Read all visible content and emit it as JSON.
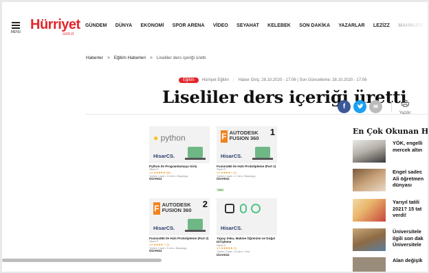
{
  "nav": {
    "menu_label": "MENU",
    "logo": "Hürriyet",
    "logo_sub": "com.tr",
    "items": [
      "GÜNDEM",
      "DÜNYA",
      "EKONOMİ",
      "SPOR ARENA",
      "VİDEO",
      "SEYAHAT",
      "KELEBEK",
      "SON DAKİKA",
      "YAZARLAR",
      "LEZİZZ",
      "MAHMURE"
    ]
  },
  "breadcrumb": {
    "items": [
      "Haberler",
      "Eğitim Haberleri",
      "Liseliler ders içeriği üretti"
    ],
    "separator": ">"
  },
  "meta": {
    "tag": "Eğitim",
    "source": "Hürriyet Eğitim",
    "dates": "Haber Giriş: 28.10.2020 - 17:06 | Son Güncelleme: 28.10.2020 - 17:06"
  },
  "article": {
    "title": "Liseliler ders içeriği üretti"
  },
  "share": {
    "facebook": "f",
    "twitter": "t",
    "email": "✉",
    "print_label": "Yazdır"
  },
  "courses": [
    {
      "brand": "python",
      "hisar": "HisarCS.",
      "title": "Python ile Programlamaya Giriş",
      "provider": "HisarCS",
      "rating": "4.8 ★★★★★ (66)",
      "meta": "Toplam 1 saat • 14 ders • Başlangıç",
      "price": "Ücretsiz",
      "badge": ""
    },
    {
      "brand": "AUTODESK FUSION 360",
      "hisar": "HisarCS.",
      "num": "1",
      "title": "Fusion360 ile Hızlı Prototipleme (Part 1)",
      "provider": "HisarCS",
      "rating": "4.0 ★★★★☆ (2)",
      "meta": "Toplam 1 saat • 17 ders • Başlangıç",
      "price": "Ücretsiz",
      "badge": "Yeni"
    },
    {
      "brand": "AUTODESK FUSION 360",
      "hisar": "HisarCS.",
      "num": "2",
      "title": "Fusion360 ile Hızlı Prototipleme (Part 2)",
      "provider": "HisarCS",
      "rating": "3.8 ★★★★☆ (3)",
      "meta": "Toplam 1 saat • 5 ders • Başlangıç",
      "price": "Ücretsiz",
      "badge": ""
    },
    {
      "brand": "",
      "hisar": "HisarCS.",
      "title": "Yapay Zeka, Makine Öğrenimi ve Doğal Dil İşleme",
      "provider": "HisarCS",
      "rating": "4.5 ★★★★★ (3)",
      "meta": "Toplam 2 saat • 15 ders • Orta",
      "price": "Ücretsiz",
      "badge": ""
    }
  ],
  "trending": {
    "title": "En Çok Okunan Haberler",
    "items": [
      {
        "text": "YÖK, engelli\nmercek altın"
      },
      {
        "text": "Engel sadec\nAli öğretmen\ndünyası"
      },
      {
        "text": "Yarıyıl tatili\n2021? 15 tat\nverdi!"
      },
      {
        "text": "Üniversitele\nilgili son dak\nÜniversitele"
      },
      {
        "text": "Alan değişik"
      }
    ]
  }
}
